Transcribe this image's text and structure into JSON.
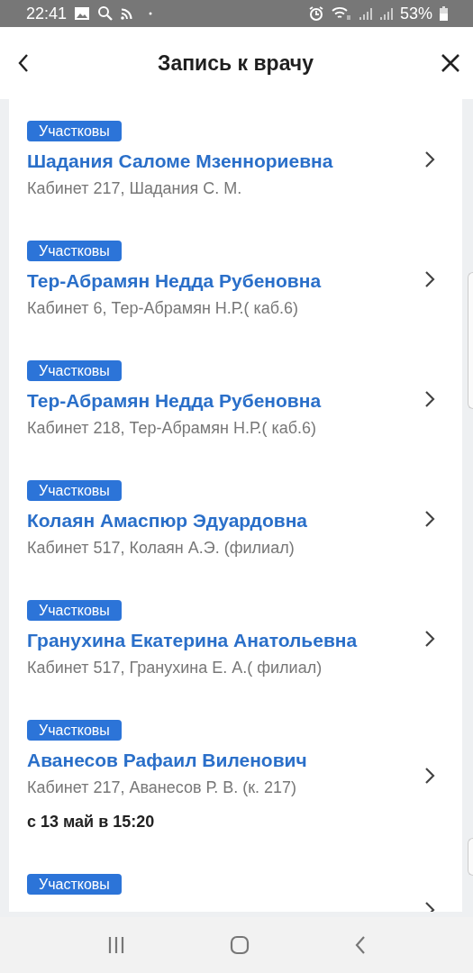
{
  "status_bar": {
    "time": "22:41",
    "battery": "53%"
  },
  "header": {
    "title": "Запись к врачу"
  },
  "doctors": [
    {
      "badge": "Участковы",
      "name": "Шадания Саломе Мзенноpиевна",
      "room": "Кабинет 217, Шадания С. М."
    },
    {
      "badge": "Участковы",
      "name": "Тер-Абрамян Недда Рубеновна",
      "room": "Кабинет 6, Тер-Абрамян Н.Р.( каб.6)"
    },
    {
      "badge": "Участковы",
      "name": "Тер-Абрамян Недда Рубеновна",
      "room": "Кабинет 218, Тер-Абрамян Н.Р.( каб.6)"
    },
    {
      "badge": "Участковы",
      "name": "Колаян Амаспюр Эдуардовна",
      "room": "Кабинет 517, Колаян А.Э. (филиал)"
    },
    {
      "badge": "Участковы",
      "name": "Гранухина Екатерина Анатольевна",
      "room": "Кабинет 517, Гранухина Е. А.( филиал)"
    },
    {
      "badge": "Участковы",
      "name": "Аванесов Рафаил Виленович",
      "room": "Кабинет 217, Аванесов Р. В. (к. 217)",
      "date": "с 13 май в 15:20"
    },
    {
      "badge": "Участковы"
    }
  ]
}
